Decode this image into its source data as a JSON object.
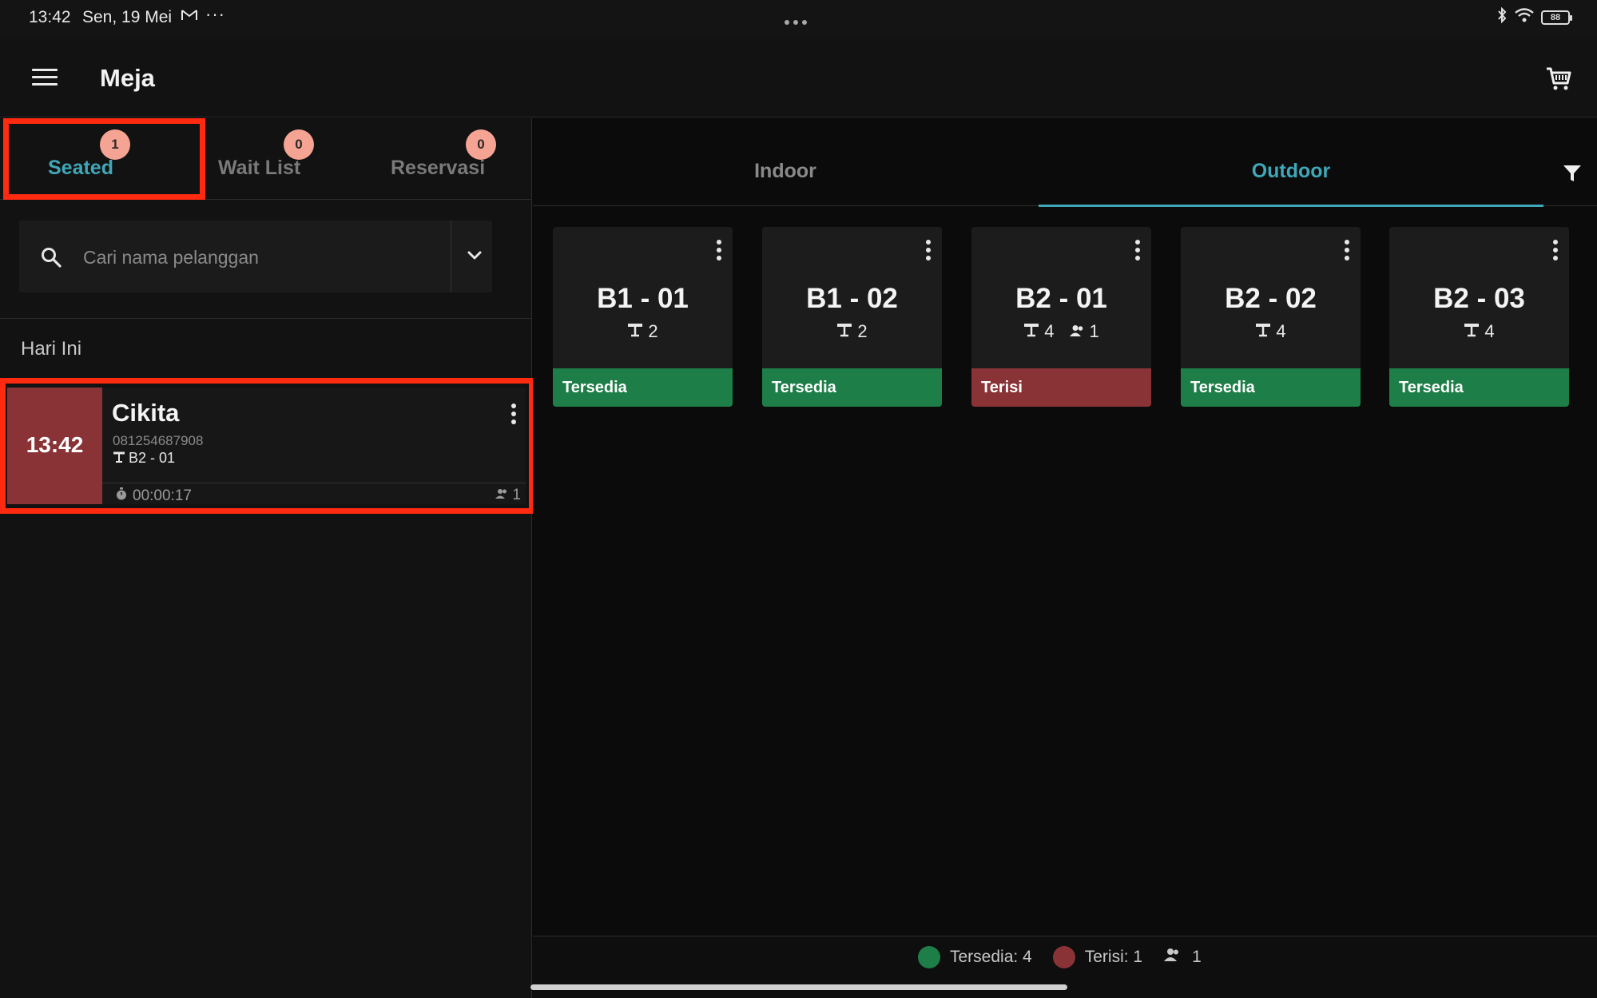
{
  "status_bar": {
    "time": "13:42",
    "date": "Sen, 19 Mei",
    "mail_icon": "gmail-icon",
    "more": "···",
    "battery": "88"
  },
  "app_bar": {
    "title": "Meja",
    "menu_icon": "hamburger-menu-icon",
    "cart_icon": "cart-icon"
  },
  "left_tabs": [
    {
      "label": "Seated",
      "badge": "1",
      "active": true
    },
    {
      "label": "Wait List",
      "badge": "0",
      "active": false
    },
    {
      "label": "Reservasi",
      "badge": "0",
      "active": false
    }
  ],
  "search": {
    "placeholder": "Cari nama pelanggan"
  },
  "section": {
    "label": "Hari Ini"
  },
  "seated_card": {
    "time": "13:42",
    "name": "Cikita",
    "phone": "081254687908",
    "table": "B2 - 01",
    "duration": "00:00:17",
    "guests": "1"
  },
  "area_tabs": [
    {
      "label": "Indoor",
      "active": false
    },
    {
      "label": "Outdoor",
      "active": true
    }
  ],
  "tables": [
    {
      "name": "B1 - 01",
      "seats": "2",
      "guests": "",
      "status": "Tersedia",
      "status_color": "#1e7e48"
    },
    {
      "name": "B1 - 02",
      "seats": "2",
      "guests": "",
      "status": "Tersedia",
      "status_color": "#1e7e48"
    },
    {
      "name": "B2 - 01",
      "seats": "4",
      "guests": "1",
      "status": "Terisi",
      "status_color": "#8a3337"
    },
    {
      "name": "B2 - 02",
      "seats": "4",
      "guests": "",
      "status": "Tersedia",
      "status_color": "#1e7e48"
    },
    {
      "name": "B2 - 03",
      "seats": "4",
      "guests": "",
      "status": "Tersedia",
      "status_color": "#1e7e48"
    }
  ],
  "legend": {
    "available_label": "Tersedia: 4",
    "available_color": "#1e7e48",
    "occupied_label": "Terisi: 1",
    "occupied_color": "#8a3337",
    "guests_total": "1"
  },
  "colors": {
    "accent": "#3fa7b8",
    "highlight": "#ff2a10",
    "badge": "#f5a393"
  }
}
